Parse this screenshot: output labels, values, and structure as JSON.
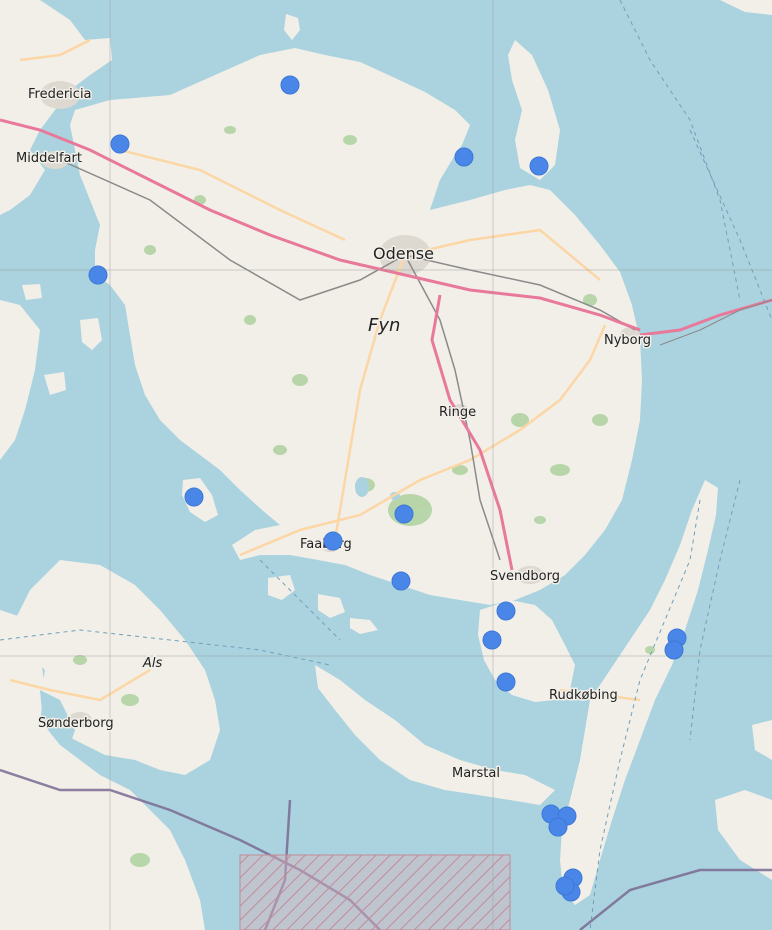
{
  "map": {
    "colors": {
      "water": "#aad3df",
      "land": "#f2efe9",
      "farmland": "#eef0d5",
      "forest": "#add19e",
      "motorway": "#e8799a",
      "primary_road": "#fcd6a4",
      "border": "#7a6a92",
      "marker": "#4a86e8"
    },
    "labels": {
      "fredericia": "Fredericia",
      "middelfart": "Middelfart",
      "odense": "Odense",
      "fyn": "Fyn",
      "nyborg": "Nyborg",
      "ringe": "Ringe",
      "faaborg": "Faaborg",
      "svendborg": "Svendborg",
      "als": "Als",
      "sonderborg": "Sønderborg",
      "rudkobing": "Rudkøbing",
      "marstal": "Marstal"
    },
    "marker_count": 20,
    "marker_icon": "location-dot-icon"
  }
}
